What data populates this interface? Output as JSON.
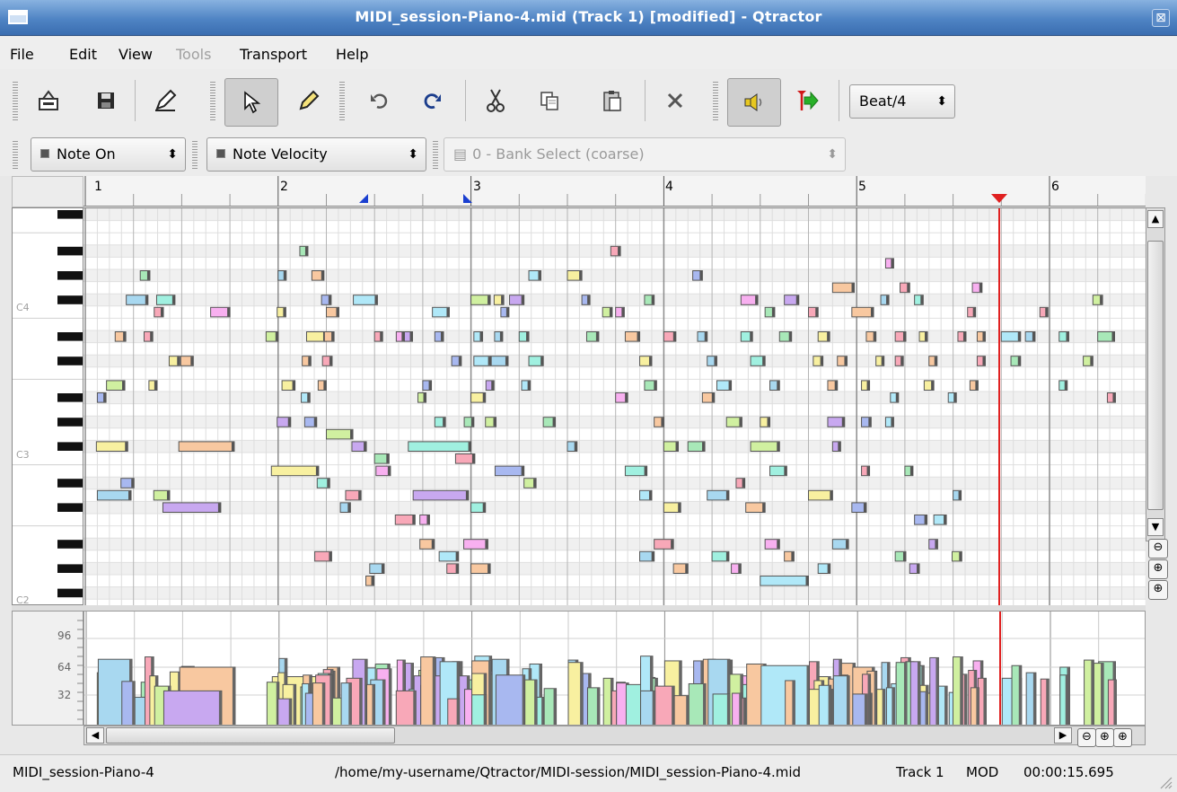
{
  "window": {
    "title": "MIDI_session-Piano-4.mid (Track 1) [modified] - Qtractor",
    "close_glyph": "⊠"
  },
  "menu": [
    {
      "label": "File",
      "enabled": true
    },
    {
      "label": "Edit",
      "enabled": true
    },
    {
      "label": "View",
      "enabled": true
    },
    {
      "label": "Tools",
      "enabled": false
    },
    {
      "label": "Transport",
      "enabled": true
    },
    {
      "label": "Help",
      "enabled": true
    }
  ],
  "toolbar": {
    "snap_label": "Beat/4",
    "icons": [
      "properties-icon",
      "save-icon",
      "edit-icon",
      "select-pointer-icon",
      "draw-pencil-icon",
      "undo-icon",
      "redo-icon",
      "cut-icon",
      "copy-icon",
      "paste-icon",
      "delete-icon",
      "audition-speaker-icon",
      "follow-playhead-icon"
    ]
  },
  "view_bar": {
    "event_type": "Note On",
    "event_param": "Note Velocity",
    "controller": "0 - Bank Select (coarse)"
  },
  "ruler": {
    "bars": [
      "1",
      "2",
      "3",
      "4",
      "5",
      "6"
    ]
  },
  "keyboard": {
    "labels": [
      "C4",
      "C3",
      "C2"
    ]
  },
  "velocity_scale": {
    "labels": [
      "96",
      "64",
      "32"
    ]
  },
  "colors": {
    "playhead": "#e02020",
    "loop_marker": "#1a3fd0",
    "grid_beat": "#b5b5b5",
    "grid_sub": "#dddddd"
  },
  "notes": [
    {
      "key": 0,
      "beat": 0.0,
      "len": 0.0
    },
    {
      "key": 27,
      "beat": 1.14,
      "len": 0.2
    },
    {
      "key": 25,
      "beat": 0.85,
      "len": 0.45
    },
    {
      "key": 25,
      "beat": 1.48,
      "len": 0.38
    },
    {
      "key": 24,
      "beat": 1.43,
      "len": 0.19
    },
    {
      "key": 24,
      "beat": 2.6,
      "len": 0.4
    },
    {
      "key": 22,
      "beat": 0.62,
      "len": 0.22
    },
    {
      "key": 22,
      "beat": 1.22,
      "len": 0.18
    },
    {
      "key": 20,
      "beat": 1.74,
      "len": 0.22
    },
    {
      "key": 20,
      "beat": 1.98,
      "len": 0.26
    },
    {
      "key": 18,
      "beat": 0.44,
      "len": 0.38
    },
    {
      "key": 18,
      "beat": 1.32,
      "len": 0.11
    },
    {
      "key": 17,
      "beat": 0.25,
      "len": 0.18
    },
    {
      "key": 13,
      "beat": 0.23,
      "len": 0.65
    },
    {
      "key": 13,
      "beat": 1.94,
      "len": 1.15
    },
    {
      "key": 16,
      "beat": 2.0,
      "len": 0.35
    },
    {
      "key": 15,
      "beat": 2.0,
      "len": 0.46
    },
    {
      "key": 15,
      "beat": 2.44,
      "len": 0.17
    },
    {
      "key": 15,
      "beat": 2.99,
      "len": 0.33
    },
    {
      "key": 11,
      "beat": 3.86,
      "len": 0.98
    },
    {
      "key": 10,
      "beat": 0.74,
      "len": 0.27
    },
    {
      "key": 9,
      "beat": 0.25,
      "len": 0.7
    },
    {
      "key": 9,
      "beat": 1.42,
      "len": 0.33
    },
    {
      "key": 9,
      "beat": 3.91,
      "len": 0.25
    },
    {
      "key": 8,
      "beat": 1.61,
      "len": 1.2
    }
  ],
  "status": {
    "file": "MIDI_session-Piano-4",
    "path": "/home/my-username/Qtractor/MIDI-session/MIDI_session-Piano-4.mid",
    "track": "Track 1",
    "mod": "MOD",
    "time": "00:00:15.695"
  }
}
